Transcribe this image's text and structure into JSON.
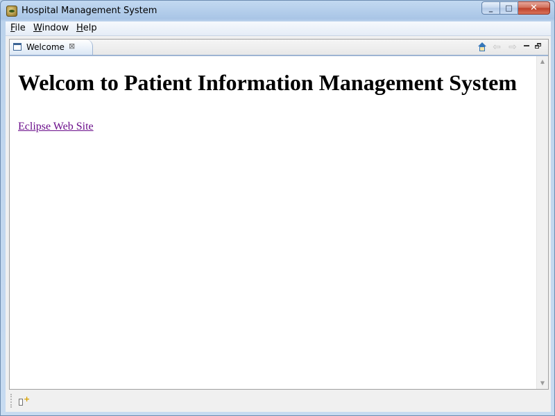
{
  "window": {
    "title": "Hospital Management System",
    "app_icon": "eclipse-rcp-icon",
    "controls": {
      "minimize": "_",
      "maximize": "□",
      "close": "✕"
    }
  },
  "menubar": {
    "items": [
      {
        "label_u": "F",
        "label_rest": "ile"
      },
      {
        "label_u": "W",
        "label_rest": "indow"
      },
      {
        "label_u": "H",
        "label_rest": "elp"
      }
    ]
  },
  "editor": {
    "tab": {
      "label": "Welcome",
      "icon": "window-icon",
      "close_glyph": "⊠"
    },
    "toolbar": {
      "home_icon": "home-icon",
      "back_glyph": "⇦",
      "forward_glyph": "⇨",
      "minimize_icon": "minimize-view-icon",
      "restore_icon": "restore-view-icon"
    }
  },
  "content": {
    "heading": "Welcom to Patient Information Management System",
    "link": "Eclipse Web Site"
  },
  "scrollbar": {
    "up_glyph": "▲",
    "down_glyph": "▼"
  },
  "statusbar": {
    "icon": "fast-view-icon"
  }
}
